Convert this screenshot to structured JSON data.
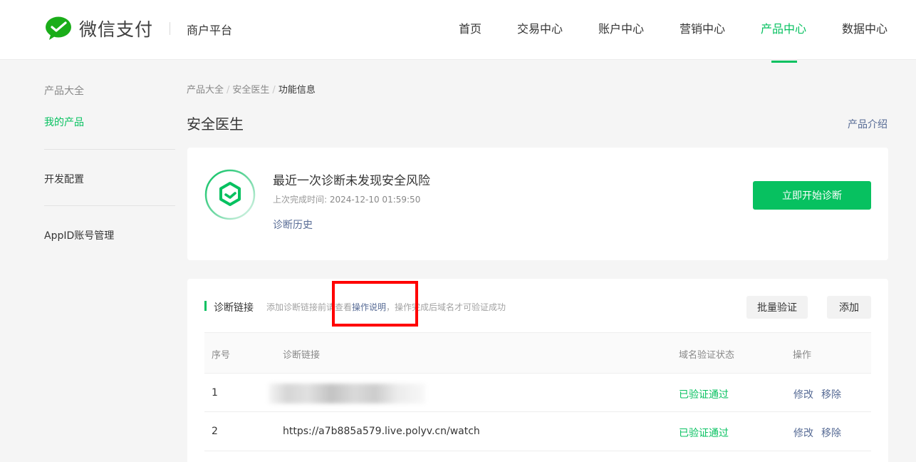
{
  "header": {
    "logo_text": "微信支付",
    "platform": "商户平台",
    "nav": [
      "首页",
      "交易中心",
      "账户中心",
      "营销中心",
      "产品中心",
      "数据中心"
    ],
    "nav_active": "产品中心",
    "brand_color": "#07c160"
  },
  "sidebar": {
    "section1": "产品大全",
    "item_my_products": "我的产品",
    "item_dev_config": "开发配置",
    "item_appid": "AppID账号管理"
  },
  "breadcrumb": [
    "产品大全",
    "安全医生",
    "功能信息"
  ],
  "page": {
    "title": "安全医生",
    "intro_link": "产品介绍"
  },
  "diagnosis": {
    "title": "最近一次诊断未发现安全风险",
    "time_label": "上次完成时间:",
    "time_value": "2024-12-10 01:59:50",
    "history_link": "诊断历史",
    "start_button": "立即开始诊断"
  },
  "links_section": {
    "title": "诊断链接",
    "tip_prefix": "添加诊断链接前请查看",
    "tip_link": "操作说明",
    "tip_suffix": "，操作完成后域名才可验证成功",
    "batch_button": "批量验证",
    "add_button": "添加",
    "columns": [
      "序号",
      "诊断链接",
      "域名验证状态",
      "操作"
    ],
    "rows": [
      {
        "index": "1",
        "url": "",
        "status": "已验证通过",
        "edit": "修改",
        "remove": "移除"
      },
      {
        "index": "2",
        "url": "https://a7b885a579.live.polyv.cn/watch",
        "status": "已验证通过",
        "edit": "修改",
        "remove": "移除"
      }
    ]
  }
}
